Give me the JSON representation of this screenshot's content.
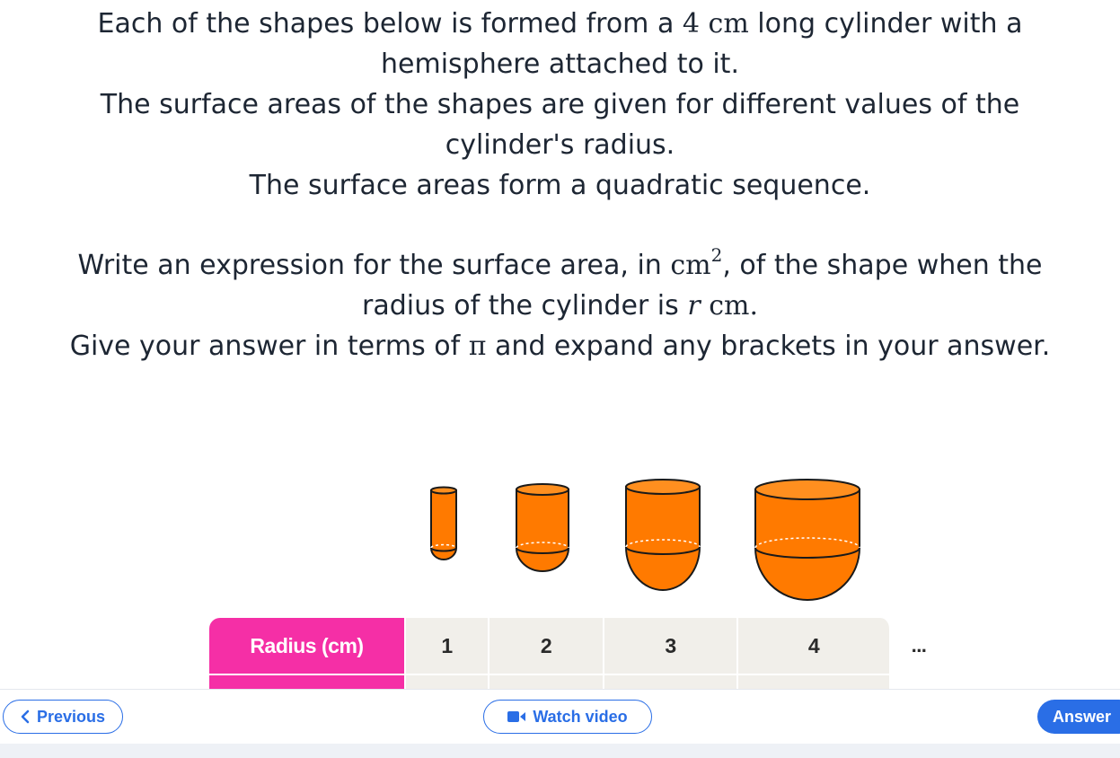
{
  "question": {
    "line1_a": "Each of the shapes below is formed from a ",
    "line1_num": "4",
    "line1_unit": "cm",
    "line1_b": " long cylinder with a",
    "line2": "hemisphere attached to it.",
    "line3": "The surface areas of the shapes are given for different values of the",
    "line4": "cylinder's radius.",
    "line5": "The surface areas form a quadratic sequence.",
    "line6_a": "Write an expression for the surface area, in ",
    "line6_unit": "cm",
    "line6_exp": "2",
    "line6_b": ", of the shape when the",
    "line7_a": "radius of the cylinder is ",
    "line7_var": "r",
    "line7_unit": "cm.",
    "line8_a": "Give your answer in terms of ",
    "line8_pi": "π",
    "line8_b": " and expand any brackets in your answer."
  },
  "shape_colors": {
    "fill": "#ff7a00",
    "top": "#ff8f1f",
    "dark": "#e96a00",
    "outline": "#1a1a1a"
  },
  "table": {
    "header": "Radius (cm)",
    "values": [
      "1",
      "2",
      "3",
      "4"
    ],
    "more": "..."
  },
  "footer": {
    "previous_label": "Previous",
    "watch_label": "Watch video",
    "answer_label": "Answer"
  },
  "colors": {
    "accent": "#2a6ee6",
    "table_header": "#f52fa6",
    "cell": "#f1efea"
  }
}
